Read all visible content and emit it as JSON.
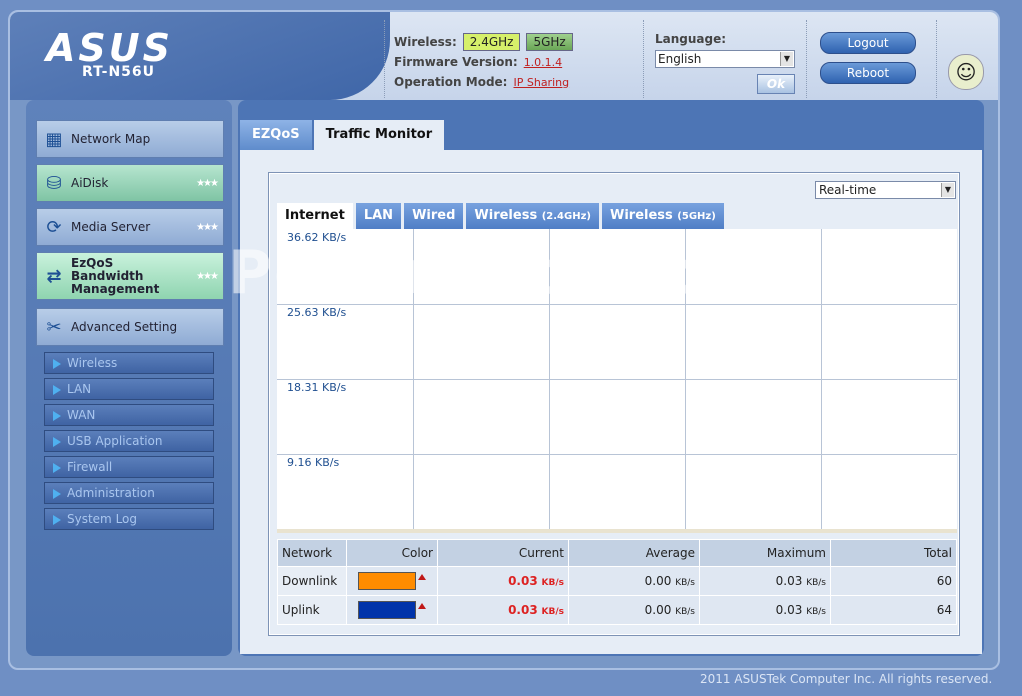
{
  "header": {
    "brand": "ASUS",
    "model": "RT-N56U",
    "wireless_label": "Wireless:",
    "band_24": "2.4GHz",
    "band_5": "5GHz",
    "firmware_label": "Firmware Version:",
    "firmware_value": "1.0.1.4",
    "opmode_label": "Operation Mode:",
    "opmode_value": "IP Sharing",
    "language_label": "Language:",
    "language_value": "English",
    "ok_label": "Ok",
    "logout_label": "Logout",
    "reboot_label": "Reboot"
  },
  "sidebar": {
    "main_items": [
      {
        "label": "Network Map"
      },
      {
        "label": "AiDisk"
      },
      {
        "label": "Media Server"
      },
      {
        "label": "EzQoS Bandwidth Management"
      },
      {
        "label": "Advanced Setting"
      }
    ],
    "sub_items": [
      {
        "label": "Wireless"
      },
      {
        "label": "LAN"
      },
      {
        "label": "WAN"
      },
      {
        "label": "USB Application"
      },
      {
        "label": "Firewall"
      },
      {
        "label": "Administration"
      },
      {
        "label": "System Log"
      }
    ]
  },
  "main": {
    "tabs": [
      {
        "label": "EZQoS"
      },
      {
        "label": "Traffic Monitor"
      }
    ],
    "range_select": "Real-time",
    "net_tabs": [
      "Internet",
      "LAN",
      "Wired"
    ],
    "net_tab_wireless24": {
      "label": "Wireless",
      "suffix": "(2.4GHz)"
    },
    "net_tab_wireless5": {
      "label": "Wireless",
      "suffix": "(5GHz)"
    },
    "y_labels": [
      "36.62 KB/s",
      "25.63 KB/s",
      "18.31 KB/s",
      "9.16 KB/s"
    ],
    "table": {
      "headers": [
        "Network",
        "Color",
        "Current",
        "Average",
        "Maximum",
        "Total"
      ],
      "rows": [
        {
          "network": "Downlink",
          "color": "#ff8c00",
          "current": "0.03",
          "average": "0.00",
          "maximum": "0.03",
          "total": "60"
        },
        {
          "network": "Uplink",
          "color": "#0033aa",
          "current": "0.03",
          "average": "0.00",
          "maximum": "0.03",
          "total": "64"
        }
      ],
      "unit": "KB/s"
    }
  },
  "footer": "2011 ASUSTek Computer Inc. All rights reserved.",
  "watermark": "PcWinTech.com"
}
